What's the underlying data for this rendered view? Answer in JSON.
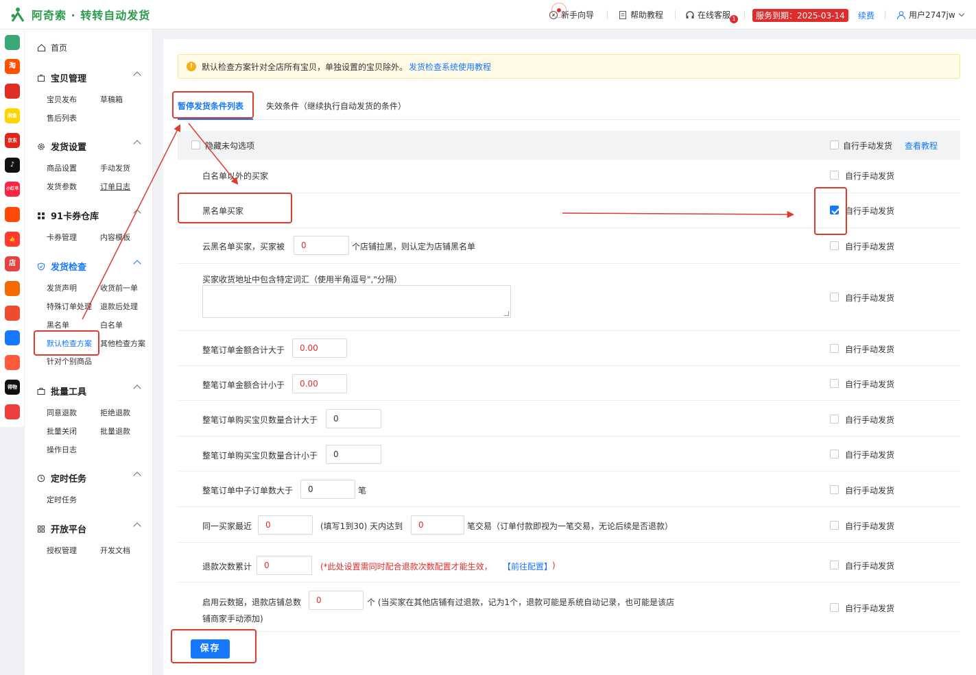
{
  "app": {
    "title": "阿奇索 · 转转自动发货"
  },
  "topbar": {
    "guide": "新手向导",
    "help": "帮助教程",
    "service": "在线客服",
    "service_badge_count": "1",
    "expiry": "服务到期：2025-03-14",
    "renew": "续费",
    "user": "用户2747jw"
  },
  "rail": [
    {
      "name": "grid-app-icon",
      "text": "",
      "color": "#3aa876"
    },
    {
      "name": "taobao-icon",
      "text": "淘",
      "color": "#ff5000"
    },
    {
      "name": "pinduoduo-icon",
      "text": "",
      "color": "#e02e24"
    },
    {
      "name": "xianyu-icon",
      "text": "闲鱼",
      "color": "#ffd400"
    },
    {
      "name": "jd-icon",
      "text": "京东",
      "color": "#e1251b"
    },
    {
      "name": "douyin-icon",
      "text": "♪",
      "color": "#111111"
    },
    {
      "name": "xiaohongshu-icon",
      "text": "小红书",
      "color": "#ff2442"
    },
    {
      "name": "kuaishou-icon",
      "text": "",
      "color": "#ff4906"
    },
    {
      "name": "thumb-icon",
      "text": "👍",
      "color": "#ff3b30"
    },
    {
      "name": "shop-icon",
      "text": "店",
      "color": "#e64340"
    },
    {
      "name": "bag-icon",
      "text": "",
      "color": "#f56a00"
    },
    {
      "name": "shopee-icon",
      "text": "",
      "color": "#ee4d2d"
    },
    {
      "name": "link-icon",
      "text": "",
      "color": "#1677ff"
    },
    {
      "name": "face-icon",
      "text": "",
      "color": "#ff5a3c"
    },
    {
      "name": "dewu-icon",
      "text": "得物",
      "color": "#111111"
    },
    {
      "name": "shield-app-icon",
      "text": "",
      "color": "#ee3d3d"
    }
  ],
  "sidebar": {
    "home": "首页",
    "groups": [
      {
        "title": "宝贝管理",
        "items": [
          "宝贝发布",
          "草稿箱",
          "售后列表"
        ]
      },
      {
        "title": "发货设置",
        "items": [
          "商品设置",
          "手动发货",
          "发货参数",
          "订单日志"
        ]
      },
      {
        "title": "91卡券仓库",
        "items": [
          "卡券管理",
          "内容模板"
        ]
      },
      {
        "title": "发货检查",
        "items": [
          "发货声明",
          "收货前一单",
          "特殊订单处理",
          "退款后处理",
          "黑名单",
          "白名单",
          "默认检查方案",
          "其他检查方案",
          "针对个别商品"
        ]
      },
      {
        "title": "批量工具",
        "items": [
          "同意退款",
          "拒绝退款",
          "批量关闭",
          "批量退款",
          "操作日志"
        ]
      },
      {
        "title": "定时任务",
        "items": [
          "定时任务"
        ]
      },
      {
        "title": "开放平台",
        "items": [
          "授权管理",
          "开发文档"
        ]
      }
    ]
  },
  "notice": {
    "text": "默认检查方案针对全店所有宝贝，单独设置的宝贝除外。",
    "link": "发货检查系统使用教程"
  },
  "tabs": [
    "暂停发货条件列表",
    "失效条件（继续执行自动发货的条件）"
  ],
  "table": {
    "hide_unchecked": "隐藏未勾选项",
    "manual_label": "自行手动发货",
    "view_tutorial": "查看教程"
  },
  "rows": [
    {
      "label": "白名单以外的买家",
      "checked": false
    },
    {
      "label": "黑名单买家",
      "checked": true
    },
    {
      "label_a": "云黑名单买家，买家被",
      "value": "0",
      "label_b": "个店铺拉黑，则认定为店铺黑名单",
      "checked": false
    },
    {
      "label": "买家收货地址中包含特定词汇（使用半角逗号\",\"分隔）",
      "value": "",
      "checked": false
    },
    {
      "label": "整笔订单金额合计大于",
      "value": "0.00",
      "checked": false
    },
    {
      "label": "整笔订单金额合计小于",
      "value": "0.00",
      "checked": false
    },
    {
      "label": "整笔订单购买宝贝数量合计大于",
      "value": "0",
      "checked": false
    },
    {
      "label": "整笔订单购买宝贝数量合计小于",
      "value": "0",
      "checked": false
    },
    {
      "label": "整笔订单中子订单数大于",
      "value": "0",
      "unit": "笔",
      "checked": false
    },
    {
      "label_a": "同一买家最近",
      "value_a": "0",
      "label_b": "(填写1到30) 天内达到",
      "value_b": "0",
      "label_c": "笔交易（订单付款即视为一笔交易，无论后续是否退款）",
      "checked": false
    },
    {
      "label": "退款次数累计",
      "value": "0",
      "note": "(*此处设置需同时配合退款次数配置才能生效，",
      "note_link": "【前往配置】",
      "note_end": ")",
      "checked": false
    },
    {
      "label_a": "启用云数据，退款店铺总数",
      "value": "0",
      "label_b": "个 (当买家在其他店铺有过退款，记为1个，退款可能是系统自动记录，也可能是该店",
      "label_c": "铺商家手动添加)",
      "checked": false
    }
  ],
  "save_label": "保存",
  "colors": {
    "accent": "#1677ff",
    "brand": "#2b9c4c",
    "annotation": "#e03a2a",
    "danger": "#e02c2c"
  }
}
